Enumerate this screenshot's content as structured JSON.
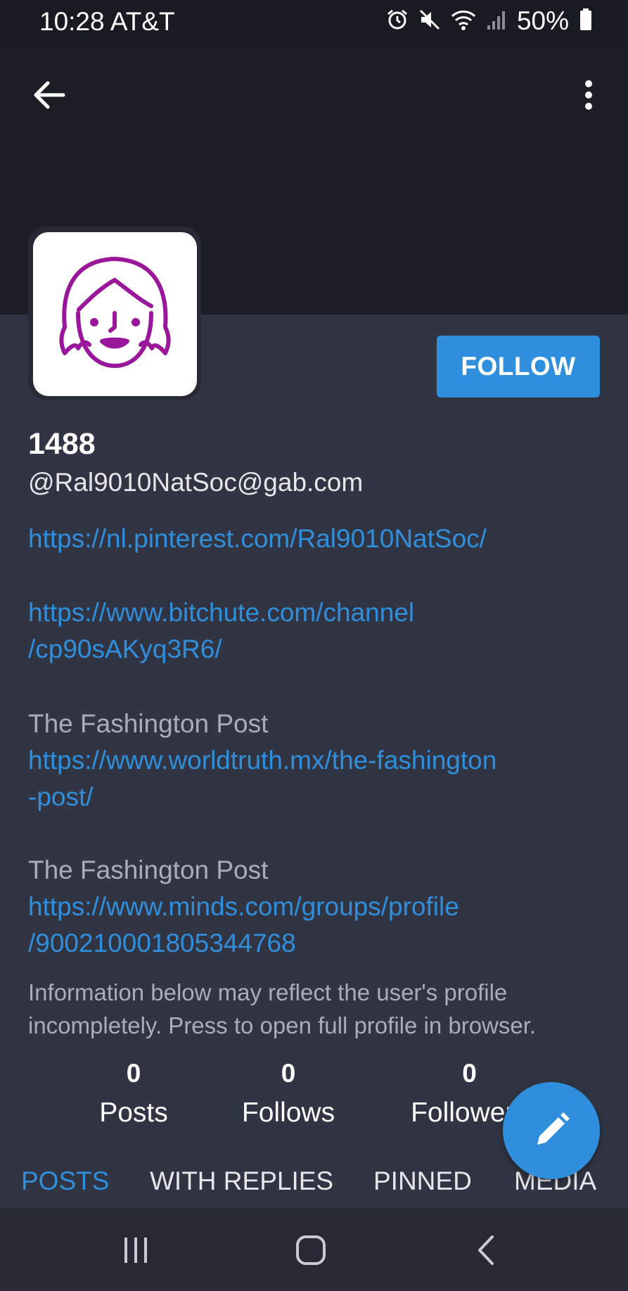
{
  "status_bar": {
    "time_carrier": "10:28 AT&T",
    "battery": "50%",
    "icons": [
      "alarm-icon",
      "mute-icon",
      "wifi-icon",
      "signal-icon",
      "battery-icon"
    ]
  },
  "header": {
    "back_icon": "arrow-left-icon",
    "more_icon": "more-vertical-icon"
  },
  "profile": {
    "avatar_icon": "girl-face-icon",
    "avatar_color": "#9a169a",
    "follow_label": "FOLLOW",
    "display_name": "1488",
    "handle": "@Ral9010NatSoc@gab.com"
  },
  "bio": {
    "link1": "https://nl.pinterest.com/Ral9010NatSoc/",
    "link2_line1": "https://www.bitchute.com/channel",
    "link2_line2": "/cp90sAKyq3R6/",
    "text3": "The Fashington Post",
    "link3_line1": "https://www.worldtruth.mx/the-fashington",
    "link3_line2": "-post/",
    "text4": "The Fashington Post",
    "link4_line1": "https://www.minds.com/groups/profile",
    "link4_line2": "/900210001805344768"
  },
  "notice": {
    "line1": "Information below may reflect the user's profile",
    "line2": "incompletely. Press to open full profile in browser."
  },
  "stats": {
    "posts_value": "0",
    "posts_label": "Posts",
    "follows_value": "0",
    "follows_label": "Follows",
    "followers_value": "0",
    "followers_label": "Followers"
  },
  "tabs": {
    "posts": "POSTS",
    "with_replies": "WITH REPLIES",
    "pinned": "PINNED",
    "media": "MEDIA"
  },
  "fab": {
    "icon": "pencil-icon"
  },
  "nav_bar": {
    "icons": [
      "recent-apps-icon",
      "home-icon",
      "back-icon"
    ]
  },
  "colors": {
    "accent": "#2f8fdc",
    "background": "#313543",
    "header_background": "#1c1e25"
  }
}
